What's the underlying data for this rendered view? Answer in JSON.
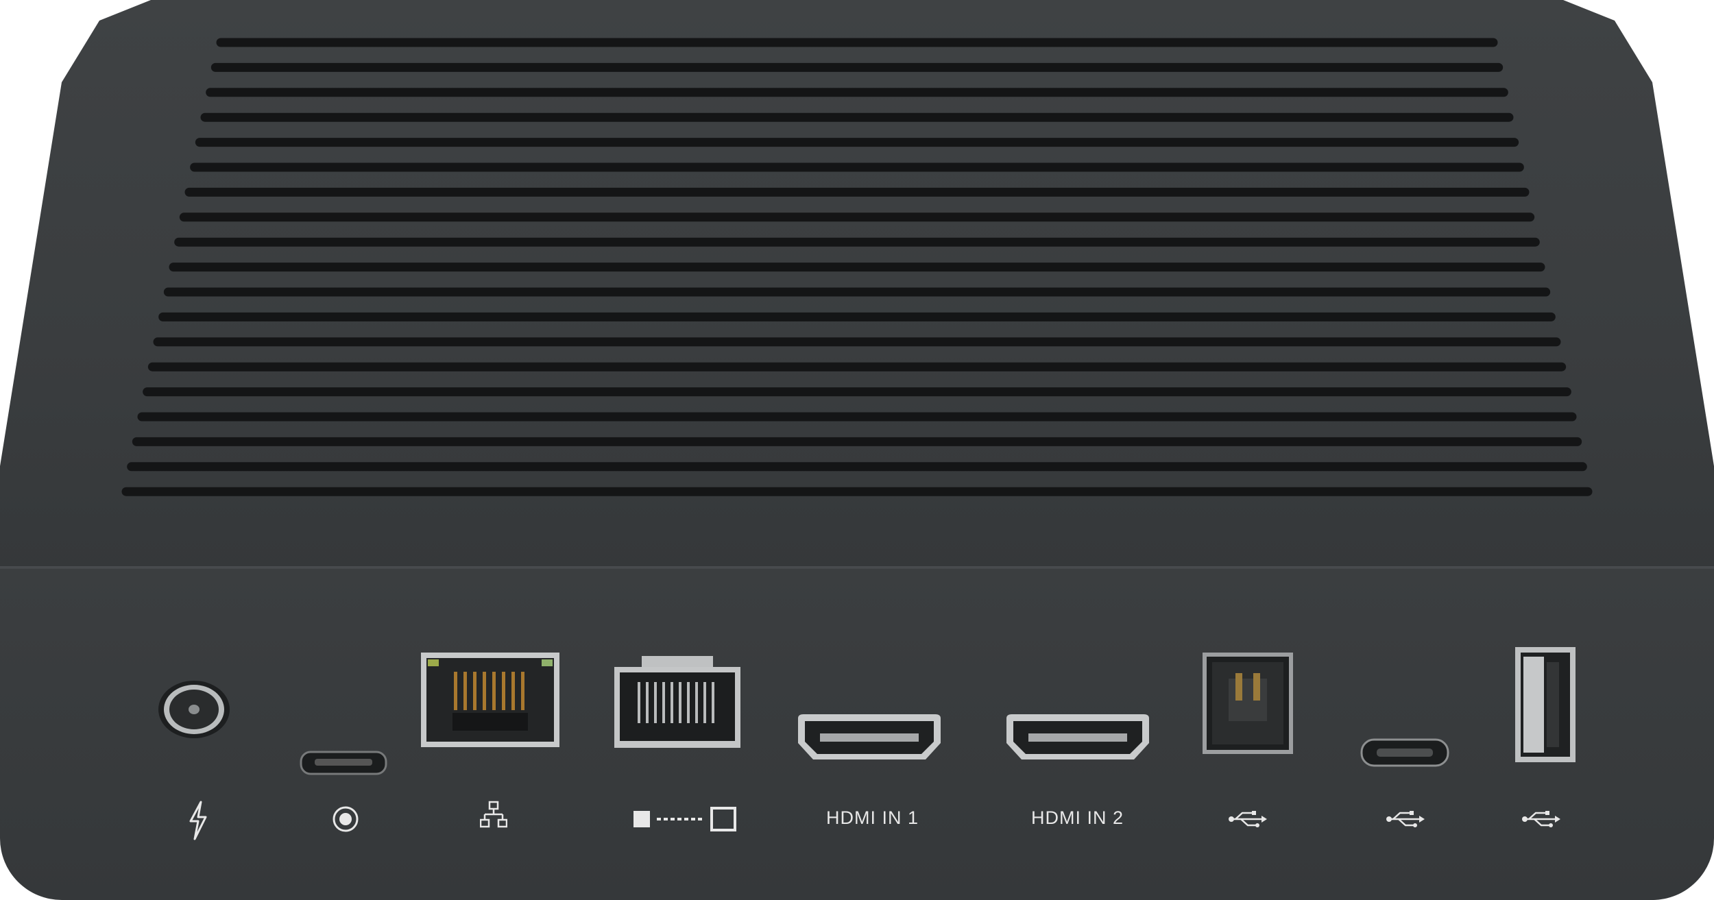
{
  "device": {
    "body_color": "#3a3d3f",
    "label_color": "#e8e8e8",
    "port_labels": {
      "hdmi_in_1": "HDMI IN 1",
      "hdmi_in_2": "HDMI IN 2"
    },
    "port_icons": [
      "power-icon",
      "reset-button-icon",
      "network-icon",
      "display-extend-icon",
      "usb-icon",
      "usb-icon",
      "usb-icon"
    ]
  }
}
